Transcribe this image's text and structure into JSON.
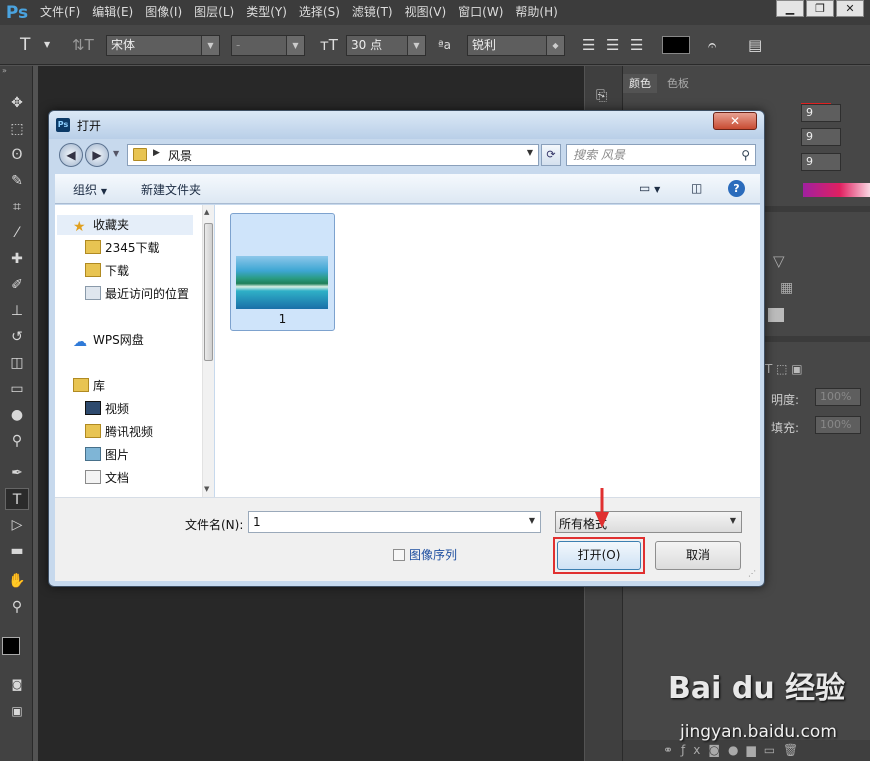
{
  "app": {
    "logo": "Ps",
    "menu": [
      "文件(F)",
      "编辑(E)",
      "图像(I)",
      "图层(L)",
      "类型(Y)",
      "选择(S)",
      "滤镜(T)",
      "视图(V)",
      "窗口(W)",
      "帮助(H)"
    ],
    "window_controls": [
      "▁",
      "❐",
      "✕"
    ]
  },
  "options": {
    "font_family": "宋体",
    "font_style": "-",
    "font_size": "30 点",
    "antialias": "锐利"
  },
  "panels": {
    "color_tab": "颜色",
    "swatches_tab": "色板",
    "r_value": "9",
    "g_value": "9",
    "b_value": "9",
    "opacity_label": "明度:",
    "opacity_value": "100%",
    "fill_label": "填充:",
    "fill_value": "100%"
  },
  "dialog": {
    "title": "打开",
    "path": "风景",
    "search_placeholder": "搜索 风景",
    "organize": "组织",
    "new_folder": "新建文件夹",
    "nav": {
      "favorites": "收藏夹",
      "downloads_2345": "2345下载",
      "downloads": "下载",
      "recent": "最近访问的位置",
      "wps": "WPS网盘",
      "library": "库",
      "videos": "视频",
      "tencent_video": "腾讯视频",
      "pictures": "图片",
      "documents": "文档"
    },
    "file_name": "1",
    "filename_label": "文件名(N):",
    "filename_value": "1",
    "filetype_value": "所有格式",
    "image_sequence": "图像序列",
    "open_button": "打开(O)",
    "cancel_button": "取消"
  },
  "watermark": {
    "brand": "Bai du 经验",
    "url": "jingyan.baidu.com"
  },
  "colors": {
    "accent_red": "#e03030",
    "selection_blue": "#cfe4fa",
    "link_blue": "#1e4fa0"
  }
}
